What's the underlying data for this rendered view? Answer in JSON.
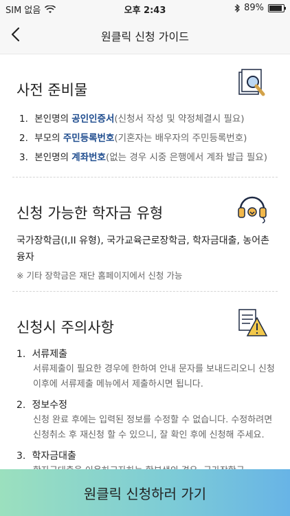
{
  "status_bar": {
    "carrier": "SIM 없음",
    "time": "오후 2:43",
    "battery": "89%",
    "battery_level": 0.89
  },
  "header": {
    "title": "원클릭 신청 가이드"
  },
  "sections": {
    "prep": {
      "title": "사전 준비물",
      "items": [
        {
          "num": "1.",
          "prefix": "본인명의 ",
          "highlight": "공인인증서",
          "suffix": "(신청서 작성 및 약정체결시 필요)"
        },
        {
          "num": "2.",
          "prefix": "부모의 ",
          "highlight": "주민등록번호",
          "suffix": "(기혼자는 배우자의 주민등록번호)"
        },
        {
          "num": "3.",
          "prefix": "본인명의 ",
          "highlight": "계좌번호",
          "suffix": "(없는 경우 시중 은행에서 계좌 발급 필요)"
        }
      ]
    },
    "types": {
      "title": "신청 가능한 학자금 유형",
      "text": "국가장학금(I,II 유형), 국가교육근로장학금, 학자금대출, 농어촌융자",
      "note": "※ 기타 장학금은 재단 홈페이지에서 신청 가능"
    },
    "cautions": {
      "title": "신청시 주의사항",
      "items": [
        {
          "num": "1.",
          "title": "서류제출",
          "body": "서류제출이 필요한 경우에 한하여 안내 문자를 보내드리오니 신청이후에 서류제출 메뉴에서 제출하시면 됩니다."
        },
        {
          "num": "2.",
          "title": "정보수정",
          "body": "신청 완료 후에는 입력된 정보를 수정할 수 없습니다. 수정하려면 신청취소 후 재신청 할 수 있으니, 잘 확인 후에 신청해 주세요."
        },
        {
          "num": "3.",
          "title": "학자금대출",
          "body": "학자금대출을 이용하고자하는 학부생의 경우, 국가장학금"
        }
      ]
    }
  },
  "cta": {
    "label": "원클릭 신청하러 가기"
  },
  "colors": {
    "highlight": "#1e4c8e",
    "cta_gradient_start": "#9be0be",
    "cta_gradient_end": "#68b4e6"
  },
  "icons": {
    "back": "back-chevron-icon",
    "prep": "document-magnifier-icon",
    "types": "headphones-icon",
    "cautions": "warning-document-icon",
    "wifi": "wifi-icon",
    "bluetooth": "bluetooth-icon",
    "battery": "battery-icon"
  }
}
